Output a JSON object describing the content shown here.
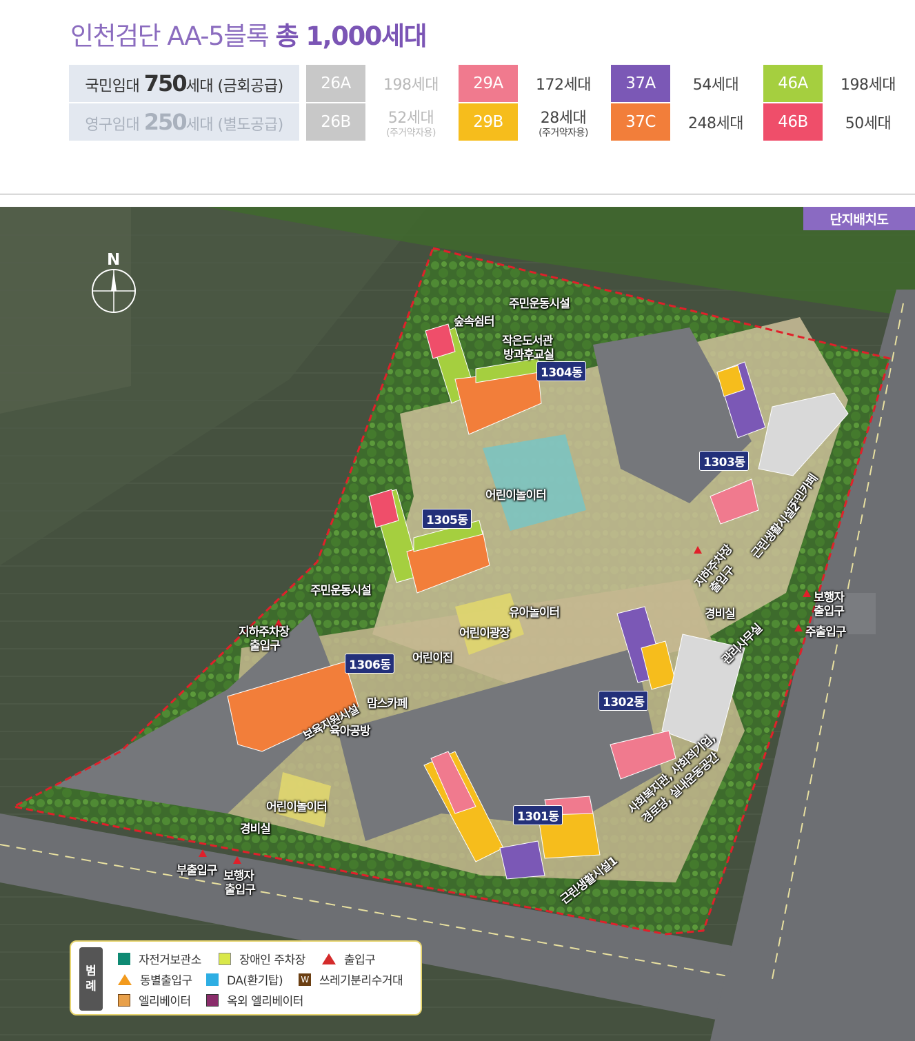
{
  "title": {
    "prefix": "인천검단 AA-5블록",
    "highlight": "총 1,000세대"
  },
  "rental": {
    "row1": {
      "label_pre": "국민임대",
      "count": "750",
      "label_post": "세대 (금회공급)"
    },
    "row2": {
      "label_pre": "영구임대",
      "count": "250",
      "label_post": "세대 (별도공급)"
    }
  },
  "units": {
    "row1": [
      {
        "type": "26A",
        "count": "198세대",
        "note": "",
        "color": "#c8c8c8",
        "muted": true
      },
      {
        "type": "29A",
        "count": "172세대",
        "note": "",
        "color": "#f07a8e",
        "muted": false
      },
      {
        "type": "37A",
        "count": "54세대",
        "note": "",
        "color": "#7b58b6",
        "muted": false
      },
      {
        "type": "46A",
        "count": "198세대",
        "note": "",
        "color": "#a5cf3f",
        "muted": false
      }
    ],
    "row2": [
      {
        "type": "26B",
        "count": "52세대",
        "note": "(주거약자용)",
        "color": "#c8c8c8",
        "muted": true
      },
      {
        "type": "29B",
        "count": "28세대",
        "note": "(주거약자용)",
        "color": "#f6bd1c",
        "muted": false
      },
      {
        "type": "37C",
        "count": "248세대",
        "note": "",
        "color": "#f27e3a",
        "muted": false
      },
      {
        "type": "46B",
        "count": "50세대",
        "note": "",
        "color": "#ef4e6a",
        "muted": false
      }
    ]
  },
  "map": {
    "badge": "단지배치도",
    "north": "N",
    "buildings": {
      "b1301": "1301동",
      "b1302": "1302동",
      "b1303": "1303동",
      "b1304": "1304동",
      "b1305": "1305동",
      "b1306": "1306동"
    },
    "labels": {
      "exercise_top": "주민운동시설",
      "forest_shelter": "숲속쉼터",
      "library": "작은도서관",
      "afterschool": "방과후교실",
      "playground_center": "어린이놀이터",
      "exercise_left": "주민운동시설",
      "parking_left": "지하주차장",
      "parking_left2": "출입구",
      "toddler_play": "유아놀이터",
      "kids_square": "어린이광장",
      "daycare": "어린이집",
      "moms_cafe": "맘스카페",
      "childcare_support": "보육지원시설",
      "childcare_room": "육아공방",
      "playground_bottom": "어린이놀이터",
      "guard_bottom": "경비실",
      "sub_entrance": "부출입구",
      "ped_bottom": "보행자",
      "ped_bottom2": "출입구",
      "parking_right": "지하주차장",
      "parking_right2": "출입구",
      "resident_cafe": "주민카페",
      "neighborhood2": "근린생활시설2",
      "ped_right": "보행자",
      "ped_right2": "출입구",
      "main_entrance": "주출입구",
      "guard_right": "경비실",
      "management": "관리사무실",
      "welfare1": "사회복지관, 사회적기업,",
      "welfare2": "경로당, 실내운동공간",
      "neighborhood1": "근린생활시설1"
    }
  },
  "legend": {
    "title": [
      "범",
      "례"
    ],
    "items": [
      {
        "label": "자전거보관소",
        "color": "#0e8a73",
        "icon": "bike-storage-icon"
      },
      {
        "label": "장애인 주차장",
        "color": "#d9e84a",
        "icon": "accessible-parking-icon"
      },
      {
        "label": "출입구",
        "color": "#d42b2b",
        "icon": "entrance-triangle-icon"
      },
      {
        "label": "동별출입구",
        "color": "#f29a1d",
        "icon": "building-entrance-triangle-icon"
      },
      {
        "label": "DA(환기탑)",
        "color": "#2eaee3",
        "icon": "ventilation-tower-icon"
      },
      {
        "label": "쓰레기분리수거대",
        "color": "#6b3f12",
        "icon": "recycling-station-icon"
      },
      {
        "label": "엘리베이터",
        "color": "#e8a04a",
        "icon": "elevator-icon"
      },
      {
        "label": "옥외 엘리베이터",
        "color": "#8a2d6b",
        "icon": "outdoor-elevator-icon"
      }
    ]
  }
}
